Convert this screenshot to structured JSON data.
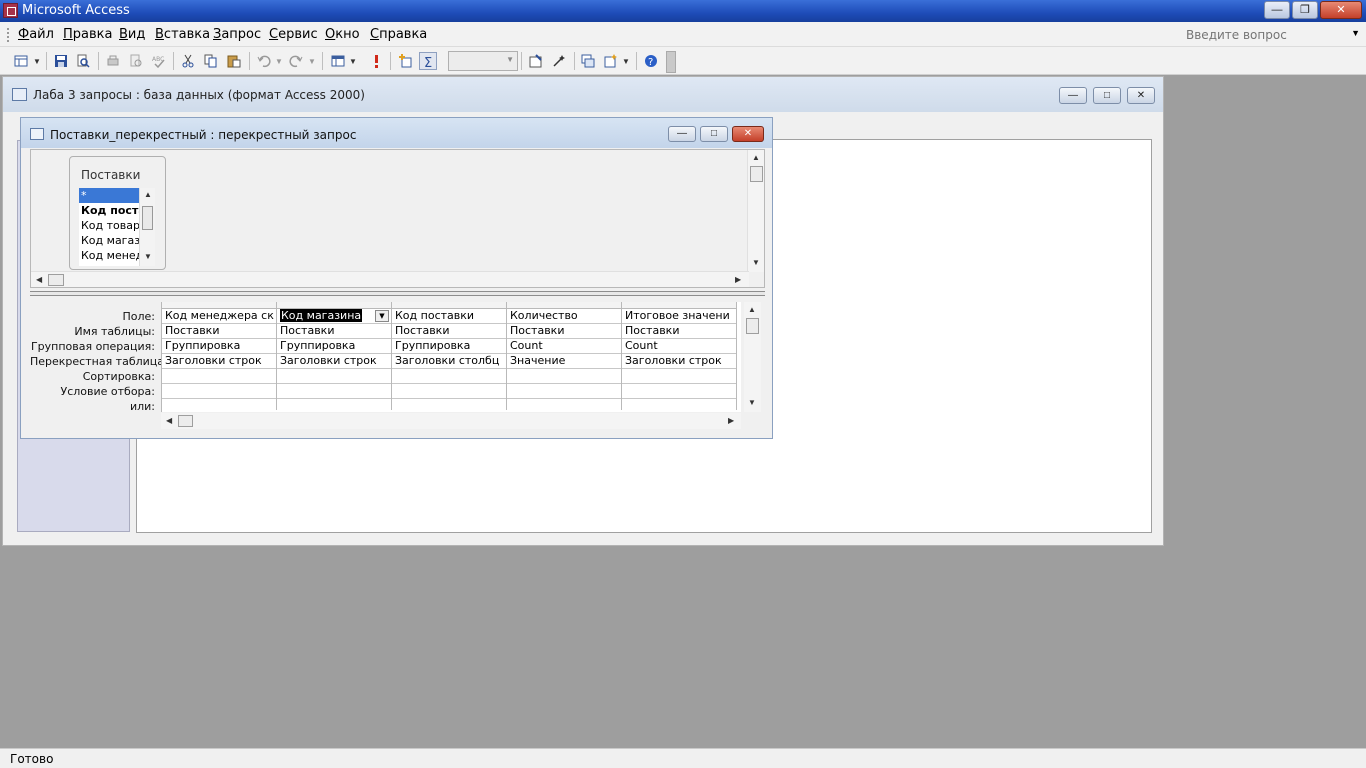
{
  "app": {
    "title": "Microsoft Access"
  },
  "menu": {
    "items": [
      "Файл",
      "Правка",
      "Вид",
      "Вставка",
      "Запрос",
      "Сервис",
      "Окно",
      "Справка"
    ],
    "help_placeholder": "Введите вопрос"
  },
  "database_window": {
    "title": "Лаба 3 запросы : база данных (формат Access 2000)"
  },
  "query_window": {
    "title": "Поставки_перекрестный : перекрестный запрос",
    "table": {
      "name": "Поставки",
      "fields": [
        "*",
        "Код постав",
        "Код товара",
        "Код магази",
        "Код менедж"
      ]
    },
    "row_labels": [
      "Поле:",
      "Имя таблицы:",
      "Групповая операция:",
      "Перекрестная таблица:",
      "Сортировка:",
      "Условие отбора:",
      "или:"
    ],
    "columns": [
      {
        "field": "Код менеджера ск",
        "table": "Поставки",
        "group": "Группировка",
        "crosstab": "Заголовки строк"
      },
      {
        "field": "Код магазина",
        "table": "Поставки",
        "group": "Группировка",
        "crosstab": "Заголовки строк"
      },
      {
        "field": "Код поставки",
        "table": "Поставки",
        "group": "Группировка",
        "crosstab": "Заголовки столбц"
      },
      {
        "field": "Количество",
        "table": "Поставки",
        "group": "Count",
        "crosstab": "Значение"
      },
      {
        "field": "Итоговое значени",
        "table": "Поставки",
        "group": "Count",
        "crosstab": "Заголовки строк"
      }
    ]
  },
  "status": {
    "text": "Готово"
  }
}
